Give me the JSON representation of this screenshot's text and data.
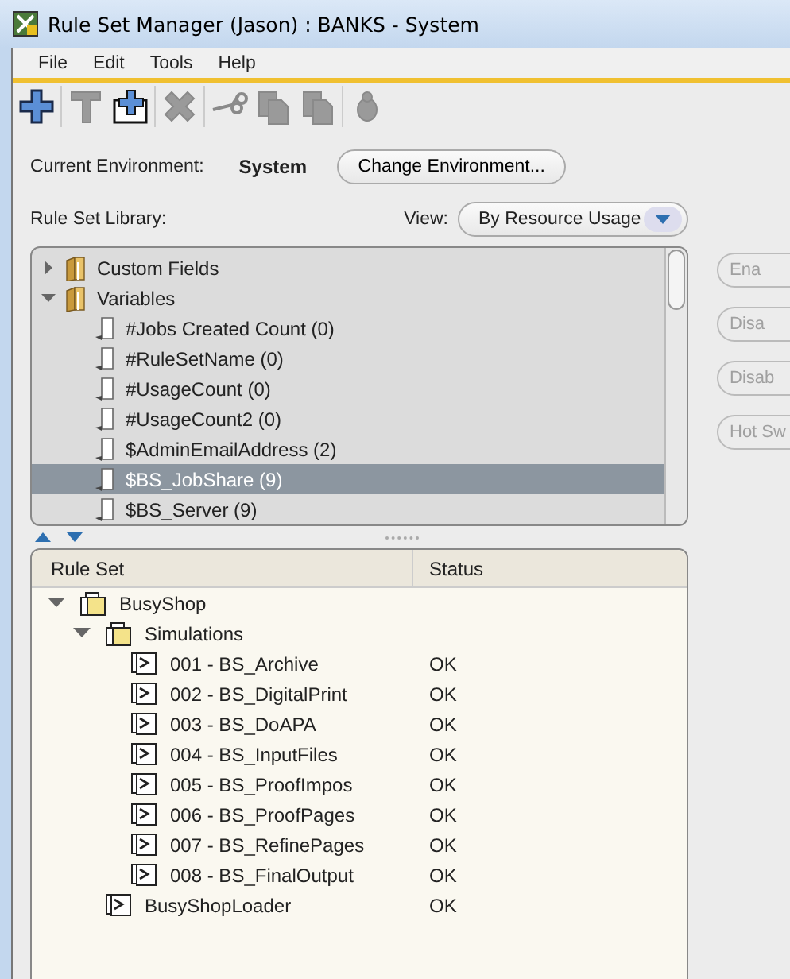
{
  "window": {
    "title": "Rule Set Manager (Jason) : BANKS - System"
  },
  "menu": [
    "File",
    "Edit",
    "Tools",
    "Help"
  ],
  "toolbar": [
    {
      "kind": "add",
      "disabled": false
    },
    {
      "kind": "edit",
      "disabled": true
    },
    {
      "kind": "new-folder",
      "disabled": false
    },
    {
      "kind": "delete",
      "disabled": true
    },
    {
      "kind": "cut",
      "disabled": true
    },
    {
      "kind": "copy",
      "disabled": true
    },
    {
      "kind": "paste",
      "disabled": true
    },
    {
      "kind": "debug",
      "disabled": true
    }
  ],
  "environment": {
    "label": "Current Environment:",
    "value": "System",
    "button": "Change Environment..."
  },
  "library": {
    "label": "Rule Set Library:",
    "view_label": "View:",
    "view_value": "By Resource Usage",
    "items": [
      {
        "label": "Custom Fields",
        "kind": "folder",
        "expanded": false,
        "selected": false
      },
      {
        "label": "Variables",
        "kind": "folder",
        "expanded": true,
        "selected": false,
        "children": [
          {
            "label": "#Jobs Created Count (0)",
            "kind": "variable",
            "selected": false
          },
          {
            "label": "#RuleSetName (0)",
            "kind": "variable",
            "selected": false
          },
          {
            "label": "#UsageCount (0)",
            "kind": "variable",
            "selected": false
          },
          {
            "label": "#UsageCount2 (0)",
            "kind": "variable",
            "selected": false
          },
          {
            "label": "$AdminEmailAddress (2)",
            "kind": "variable",
            "selected": false
          },
          {
            "label": "$BS_JobShare (9)",
            "kind": "variable",
            "selected": true
          },
          {
            "label": "$BS_Server (9)",
            "kind": "variable",
            "selected": false
          }
        ]
      }
    ]
  },
  "side_buttons": [
    {
      "label": "Ena",
      "disabled": true
    },
    {
      "label": "Disa",
      "disabled": true
    },
    {
      "label": "Disab",
      "disabled": true
    },
    {
      "label": "Hot Sw",
      "disabled": true
    }
  ],
  "rule_sets": {
    "columns": [
      "Rule Set",
      "Status"
    ],
    "rows": [
      {
        "name": "BusyShop",
        "kind": "folder",
        "expanded": true,
        "children": [
          {
            "name": "Simulations",
            "kind": "folder",
            "expanded": true,
            "children": [
              {
                "name": "001 - BS_Archive",
                "kind": "ruleset",
                "status": "OK"
              },
              {
                "name": "002 - BS_DigitalPrint",
                "kind": "ruleset",
                "status": "OK"
              },
              {
                "name": "003 - BS_DoAPA",
                "kind": "ruleset",
                "status": "OK"
              },
              {
                "name": "004 - BS_InputFiles",
                "kind": "ruleset",
                "status": "OK"
              },
              {
                "name": "005 - BS_ProofImpos",
                "kind": "ruleset",
                "status": "OK"
              },
              {
                "name": "006 - BS_ProofPages",
                "kind": "ruleset",
                "status": "OK"
              },
              {
                "name": "007 - BS_RefinePages",
                "kind": "ruleset",
                "status": "OK"
              },
              {
                "name": "008 - BS_FinalOutput",
                "kind": "ruleset",
                "status": "OK"
              }
            ]
          },
          {
            "name": "BusyShopLoader",
            "kind": "ruleset",
            "status": "OK"
          }
        ]
      }
    ]
  }
}
